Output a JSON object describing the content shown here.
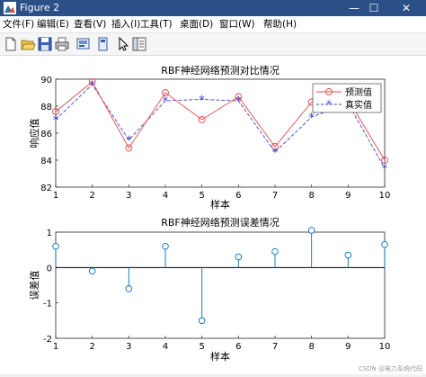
{
  "window": {
    "title": "Figure 2",
    "controls": {
      "minimize": "—",
      "maximize": "☐",
      "close": "✕"
    }
  },
  "menu": [
    "文件(F)",
    "编辑(E)",
    "查看(V)",
    "插入(I)",
    "工具(T)",
    "桌面(D)",
    "窗口(W)",
    "帮助(H)"
  ],
  "toolbar_icons": [
    "new-figure-icon",
    "open-file-icon",
    "save-icon",
    "print-icon",
    "link-icon",
    "property-editor-icon",
    "cursor-icon",
    "plot-browser-icon"
  ],
  "colors": {
    "predict": "#e8474c",
    "actual": "#3f48cc",
    "stem": "#0072bd"
  },
  "chart_data": [
    {
      "type": "line",
      "title": "RBF神经网络预测对比情况",
      "xlabel": "样本",
      "ylabel": "响应值",
      "x": [
        1,
        2,
        3,
        4,
        5,
        6,
        7,
        8,
        9,
        10
      ],
      "xlim": [
        1,
        10
      ],
      "ylim": [
        82,
        90
      ],
      "yticks": [
        82,
        84,
        86,
        88,
        90
      ],
      "legend_position": "top-right",
      "series": [
        {
          "name": "预测值",
          "values": [
            87.6,
            89.8,
            84.9,
            89.0,
            87.0,
            88.7,
            85.0,
            88.3,
            88.5,
            84.0
          ]
        },
        {
          "name": "真实值",
          "values": [
            87.0,
            89.6,
            85.5,
            88.4,
            88.5,
            88.4,
            84.6,
            87.2,
            88.2,
            83.4
          ]
        }
      ]
    },
    {
      "type": "stem",
      "title": "RBF神经网络预测误差情况",
      "xlabel": "样本",
      "ylabel": "误差值",
      "x": [
        1,
        2,
        3,
        4,
        5,
        6,
        7,
        8,
        9,
        10
      ],
      "xlim": [
        1,
        10
      ],
      "ylim": [
        -2,
        1
      ],
      "yticks": [
        -2,
        -1,
        0,
        1
      ],
      "values": [
        0.6,
        -0.1,
        -0.6,
        0.6,
        -1.5,
        0.3,
        0.45,
        1.05,
        0.35,
        0.65
      ]
    }
  ],
  "watermark": "CSDN @电力系统代码"
}
